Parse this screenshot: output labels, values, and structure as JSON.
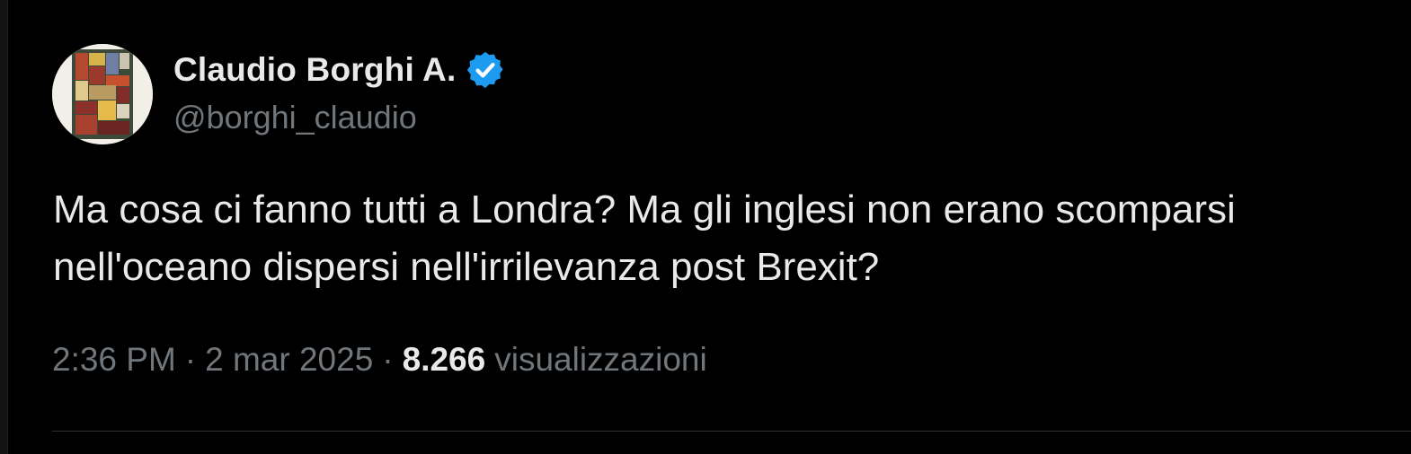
{
  "author": {
    "display_name": "Claudio Borghi A.",
    "handle": "@borghi_claudio",
    "verified": true,
    "verified_badge_color": "#1d9bf0"
  },
  "tweet": {
    "text": "Ma cosa ci fanno tutti a Londra? Ma gli inglesi non erano scomparsi\nnell'oceano dispersi nell'irrilevanza post Brexit?",
    "time": "2:36 PM",
    "separator": "·",
    "date": "2 mar 2025",
    "views_count": "8.266",
    "views_label": "visualizzazioni"
  },
  "colors": {
    "background": "#000000",
    "primary_text": "#e7e9ea",
    "secondary_text": "#71767b",
    "divider": "#2f3336"
  }
}
